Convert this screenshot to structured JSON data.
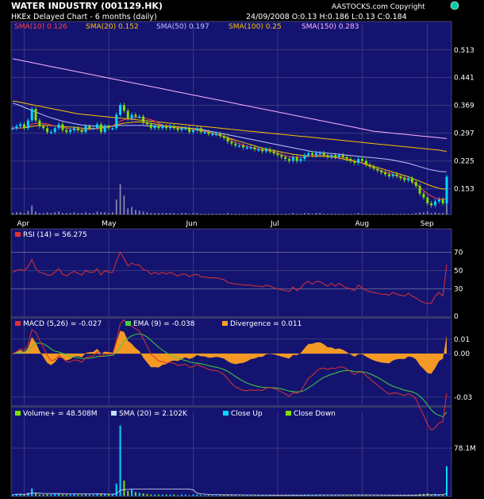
{
  "header": {
    "title": "WATER INDUSTRY (001129.HK)",
    "copyright": "AASTOCKS.com Copyright",
    "subtitle": "HKEx  Delayed Chart - 6 months (daily)",
    "quote": "24/09/2008  O:0.13  H:0.186  L:0.13  C:0.184"
  },
  "colors": {
    "panel_bg": "#141470",
    "grid": "#5a5a8c",
    "up": "#00d8ff",
    "down": "#80e000",
    "sma10": "#ff4040",
    "sma20": "#ffc000",
    "sma50": "#c0c0ff",
    "sma100": "#ffc000",
    "sma150": "#ffb0ff",
    "rsi": "#e03030",
    "macd": "#e03030",
    "ema": "#40d040",
    "divergence": "#ffa020"
  },
  "chart_data": [
    {
      "type": "candlestick",
      "title": "WATER INDUSTRY (001129.HK)",
      "x_labels": [
        "Apr",
        "May",
        "Jun",
        "Jul",
        "Aug",
        "Sep"
      ],
      "y_ticks": [
        0.153,
        0.225,
        0.297,
        0.369,
        0.441,
        0.513
      ],
      "ylim": [
        0.09,
        0.56
      ],
      "legend": [
        {
          "label": "SMA(10) 0.126"
        },
        {
          "label": "SMA(20) 0.152"
        },
        {
          "label": "SMA(50) 0.197"
        },
        {
          "label": "SMA(100) 0.25"
        },
        {
          "label": "SMA(150) 0.283"
        }
      ],
      "close": [
        0.31,
        0.315,
        0.32,
        0.31,
        0.33,
        0.36,
        0.33,
        0.315,
        0.31,
        0.3,
        0.3,
        0.31,
        0.32,
        0.305,
        0.3,
        0.305,
        0.31,
        0.305,
        0.3,
        0.315,
        0.31,
        0.31,
        0.32,
        0.3,
        0.315,
        0.31,
        0.31,
        0.345,
        0.37,
        0.355,
        0.335,
        0.345,
        0.34,
        0.34,
        0.325,
        0.32,
        0.31,
        0.315,
        0.31,
        0.315,
        0.31,
        0.315,
        0.31,
        0.305,
        0.31,
        0.31,
        0.3,
        0.305,
        0.31,
        0.3,
        0.3,
        0.295,
        0.295,
        0.295,
        0.29,
        0.285,
        0.275,
        0.27,
        0.265,
        0.265,
        0.26,
        0.26,
        0.26,
        0.255,
        0.255,
        0.25,
        0.255,
        0.25,
        0.245,
        0.24,
        0.235,
        0.23,
        0.225,
        0.235,
        0.225,
        0.23,
        0.24,
        0.245,
        0.24,
        0.245,
        0.245,
        0.24,
        0.235,
        0.24,
        0.235,
        0.24,
        0.235,
        0.23,
        0.225,
        0.22,
        0.23,
        0.225,
        0.215,
        0.21,
        0.205,
        0.2,
        0.195,
        0.19,
        0.185,
        0.19,
        0.185,
        0.18,
        0.175,
        0.18,
        0.17,
        0.16,
        0.14,
        0.13,
        0.115,
        0.11,
        0.12,
        0.125,
        0.115,
        0.184
      ],
      "sma10": [
        0.31,
        0.31,
        0.31,
        0.312,
        0.315,
        0.32,
        0.322,
        0.323,
        0.322,
        0.321,
        0.318,
        0.316,
        0.314,
        0.312,
        0.31,
        0.308,
        0.306,
        0.306,
        0.305,
        0.306,
        0.307,
        0.308,
        0.309,
        0.309,
        0.311,
        0.313,
        0.316,
        0.322,
        0.328,
        0.332,
        0.334,
        0.336,
        0.338,
        0.338,
        0.337,
        0.334,
        0.332,
        0.328,
        0.323,
        0.318,
        0.314,
        0.313,
        0.311,
        0.31,
        0.31,
        0.309,
        0.307,
        0.306,
        0.305,
        0.303,
        0.302,
        0.3,
        0.298,
        0.295,
        0.292,
        0.288,
        0.283,
        0.278,
        0.274,
        0.27,
        0.266,
        0.263,
        0.26,
        0.258,
        0.256,
        0.254,
        0.252,
        0.25,
        0.248,
        0.245,
        0.242,
        0.238,
        0.236,
        0.235,
        0.234,
        0.235,
        0.236,
        0.237,
        0.238,
        0.239,
        0.24,
        0.24,
        0.239,
        0.238,
        0.237,
        0.236,
        0.234,
        0.231,
        0.228,
        0.225,
        0.222,
        0.219,
        0.215,
        0.211,
        0.207,
        0.203,
        0.199,
        0.196,
        0.193,
        0.19,
        0.187,
        0.184,
        0.181,
        0.178,
        0.172,
        0.165,
        0.157,
        0.148,
        0.14,
        0.134,
        0.129,
        0.126,
        0.126,
        0.126
      ],
      "sma20": [
        0.31,
        0.31,
        0.31,
        0.311,
        0.312,
        0.314,
        0.316,
        0.317,
        0.317,
        0.317,
        0.317,
        0.316,
        0.315,
        0.314,
        0.313,
        0.313,
        0.312,
        0.311,
        0.31,
        0.309,
        0.309,
        0.309,
        0.31,
        0.311,
        0.312,
        0.313,
        0.315,
        0.318,
        0.321,
        0.323,
        0.324,
        0.325,
        0.326,
        0.326,
        0.325,
        0.324,
        0.322,
        0.321,
        0.319,
        0.317,
        0.316,
        0.315,
        0.314,
        0.313,
        0.312,
        0.311,
        0.31,
        0.309,
        0.307,
        0.305,
        0.303,
        0.3,
        0.297,
        0.294,
        0.291,
        0.288,
        0.285,
        0.282,
        0.279,
        0.276,
        0.273,
        0.27,
        0.267,
        0.264,
        0.261,
        0.258,
        0.256,
        0.254,
        0.252,
        0.25,
        0.248,
        0.246,
        0.244,
        0.242,
        0.241,
        0.24,
        0.239,
        0.238,
        0.237,
        0.237,
        0.237,
        0.237,
        0.236,
        0.235,
        0.234,
        0.232,
        0.23,
        0.228,
        0.226,
        0.224,
        0.222,
        0.22,
        0.217,
        0.214,
        0.211,
        0.208,
        0.205,
        0.202,
        0.199,
        0.196,
        0.193,
        0.19,
        0.187,
        0.184,
        0.18,
        0.176,
        0.172,
        0.168,
        0.164,
        0.16,
        0.157,
        0.154,
        0.152,
        0.152
      ],
      "sma50": [
        0.375,
        0.372,
        0.368,
        0.364,
        0.36,
        0.356,
        0.352,
        0.348,
        0.344,
        0.34,
        0.337,
        0.334,
        0.331,
        0.328,
        0.326,
        0.324,
        0.322,
        0.32,
        0.318,
        0.317,
        0.316,
        0.316,
        0.315,
        0.315,
        0.315,
        0.315,
        0.316,
        0.316,
        0.317,
        0.317,
        0.317,
        0.317,
        0.317,
        0.317,
        0.317,
        0.316,
        0.316,
        0.316,
        0.315,
        0.315,
        0.314,
        0.314,
        0.313,
        0.313,
        0.312,
        0.311,
        0.31,
        0.309,
        0.308,
        0.307,
        0.305,
        0.303,
        0.301,
        0.299,
        0.297,
        0.295,
        0.293,
        0.291,
        0.289,
        0.287,
        0.285,
        0.283,
        0.281,
        0.279,
        0.277,
        0.275,
        0.273,
        0.271,
        0.269,
        0.267,
        0.265,
        0.263,
        0.261,
        0.259,
        0.257,
        0.255,
        0.253,
        0.251,
        0.249,
        0.248,
        0.247,
        0.246,
        0.245,
        0.244,
        0.243,
        0.242,
        0.241,
        0.24,
        0.239,
        0.238,
        0.237,
        0.236,
        0.235,
        0.234,
        0.233,
        0.232,
        0.231,
        0.23,
        0.229,
        0.227,
        0.225,
        0.223,
        0.221,
        0.219,
        0.216,
        0.213,
        0.21,
        0.207,
        0.204,
        0.202,
        0.2,
        0.198,
        0.197,
        0.197
      ],
      "sma100": [
        0.38,
        0.379,
        0.377,
        0.375,
        0.373,
        0.371,
        0.369,
        0.367,
        0.365,
        0.363,
        0.361,
        0.359,
        0.357,
        0.355,
        0.353,
        0.351,
        0.349,
        0.347,
        0.346,
        0.345,
        0.344,
        0.343,
        0.342,
        0.341,
        0.34,
        0.339,
        0.338,
        0.337,
        0.336,
        0.335,
        0.334,
        0.333,
        0.332,
        0.331,
        0.33,
        0.329,
        0.328,
        0.327,
        0.326,
        0.325,
        0.324,
        0.323,
        0.322,
        0.321,
        0.32,
        0.319,
        0.318,
        0.317,
        0.316,
        0.315,
        0.314,
        0.313,
        0.312,
        0.311,
        0.31,
        0.309,
        0.308,
        0.307,
        0.306,
        0.305,
        0.304,
        0.303,
        0.302,
        0.301,
        0.3,
        0.299,
        0.298,
        0.297,
        0.296,
        0.295,
        0.294,
        0.293,
        0.292,
        0.291,
        0.29,
        0.289,
        0.288,
        0.287,
        0.286,
        0.285,
        0.284,
        0.283,
        0.282,
        0.281,
        0.28,
        0.279,
        0.278,
        0.277,
        0.276,
        0.275,
        0.274,
        0.273,
        0.272,
        0.271,
        0.27,
        0.269,
        0.268,
        0.267,
        0.266,
        0.265,
        0.264,
        0.263,
        0.262,
        0.261,
        0.26,
        0.259,
        0.258,
        0.257,
        0.256,
        0.255,
        0.254,
        0.253,
        0.251,
        0.25
      ],
      "sma150": [
        0.49,
        0.488,
        0.486,
        0.484,
        0.482,
        0.48,
        0.478,
        0.476,
        0.474,
        0.472,
        0.47,
        0.468,
        0.466,
        0.464,
        0.462,
        0.46,
        0.458,
        0.456,
        0.454,
        0.452,
        0.45,
        0.448,
        0.446,
        0.444,
        0.442,
        0.44,
        0.438,
        0.436,
        0.434,
        0.432,
        0.43,
        0.428,
        0.426,
        0.424,
        0.422,
        0.42,
        0.418,
        0.416,
        0.414,
        0.412,
        0.41,
        0.408,
        0.406,
        0.404,
        0.402,
        0.4,
        0.398,
        0.396,
        0.394,
        0.392,
        0.39,
        0.388,
        0.386,
        0.384,
        0.382,
        0.38,
        0.378,
        0.376,
        0.374,
        0.372,
        0.37,
        0.368,
        0.366,
        0.364,
        0.362,
        0.36,
        0.358,
        0.356,
        0.354,
        0.352,
        0.35,
        0.348,
        0.346,
        0.344,
        0.342,
        0.34,
        0.338,
        0.336,
        0.334,
        0.332,
        0.33,
        0.328,
        0.326,
        0.324,
        0.322,
        0.32,
        0.318,
        0.316,
        0.314,
        0.312,
        0.31,
        0.308,
        0.306,
        0.304,
        0.302,
        0.301,
        0.3,
        0.299,
        0.298,
        0.297,
        0.296,
        0.295,
        0.294,
        0.293,
        0.292,
        0.291,
        0.29,
        0.289,
        0.288,
        0.287,
        0.286,
        0.285,
        0.284,
        0.283
      ]
    },
    {
      "type": "line",
      "title": "RSI (14) = 56.275",
      "y_ticks": [
        0,
        30,
        50,
        70
      ],
      "ylim": [
        0,
        85
      ],
      "values": [
        48,
        50,
        51,
        50,
        54,
        62,
        52,
        48,
        47,
        45,
        45,
        48,
        52,
        46,
        44,
        47,
        49,
        47,
        45,
        50,
        48,
        48,
        52,
        45,
        50,
        48,
        48,
        60,
        70,
        63,
        55,
        58,
        56,
        56,
        51,
        50,
        46,
        48,
        46,
        48,
        46,
        48,
        46,
        44,
        46,
        46,
        43,
        45,
        46,
        43,
        43,
        42,
        42,
        42,
        41,
        40,
        37,
        36,
        35,
        35,
        34,
        34,
        34,
        33,
        33,
        32,
        34,
        33,
        31,
        30,
        29,
        28,
        27,
        32,
        28,
        31,
        36,
        38,
        35,
        38,
        38,
        35,
        33,
        36,
        33,
        36,
        33,
        31,
        30,
        28,
        34,
        31,
        28,
        27,
        26,
        25,
        24,
        24,
        23,
        26,
        24,
        23,
        22,
        25,
        22,
        20,
        17,
        15,
        14,
        14,
        22,
        26,
        22,
        56.275
      ]
    },
    {
      "type": "line",
      "title": "MACD (5,26) = -0.027",
      "y_ticks": [
        -0.03,
        0.0,
        0.01
      ],
      "ylim": [
        -0.035,
        0.017
      ],
      "series": [
        {
          "name": "MACD (5,26) = -0.027"
        },
        {
          "name": "EMA (9) = -0.038"
        },
        {
          "name": "Divergence = 0.011"
        }
      ]
    },
    {
      "type": "bar",
      "title": "Volume+ = 48.508M",
      "y_ticks": [
        78.1
      ],
      "ylim": [
        0,
        125
      ],
      "series": [
        {
          "name": "Volume+ = 48.508M"
        },
        {
          "name": "SMA (20) = 2.102K"
        },
        {
          "name": "Close Up"
        },
        {
          "name": "Close Down"
        }
      ],
      "values": [
        2,
        3,
        3,
        2,
        5,
        12,
        4,
        2,
        2,
        3,
        2,
        3,
        4,
        2,
        2,
        2,
        3,
        2,
        2,
        3,
        2,
        2,
        4,
        3,
        3,
        2,
        3,
        20,
        115,
        25,
        8,
        10,
        6,
        5,
        4,
        3,
        2,
        2,
        2,
        2,
        2,
        2,
        2,
        1,
        2,
        2,
        1,
        2,
        2,
        1,
        1,
        1,
        1,
        1,
        1,
        1,
        2,
        1,
        1,
        1,
        1,
        1,
        1,
        1,
        1,
        1,
        1,
        1,
        1,
        1,
        1,
        1,
        1,
        2,
        1,
        1,
        2,
        2,
        1,
        2,
        2,
        1,
        1,
        1,
        1,
        1,
        1,
        1,
        1,
        1,
        2,
        1,
        1,
        1,
        1,
        1,
        1,
        1,
        1,
        1,
        1,
        1,
        1,
        1,
        1,
        2,
        3,
        3,
        4,
        2,
        3,
        2,
        2,
        48.508
      ]
    }
  ]
}
